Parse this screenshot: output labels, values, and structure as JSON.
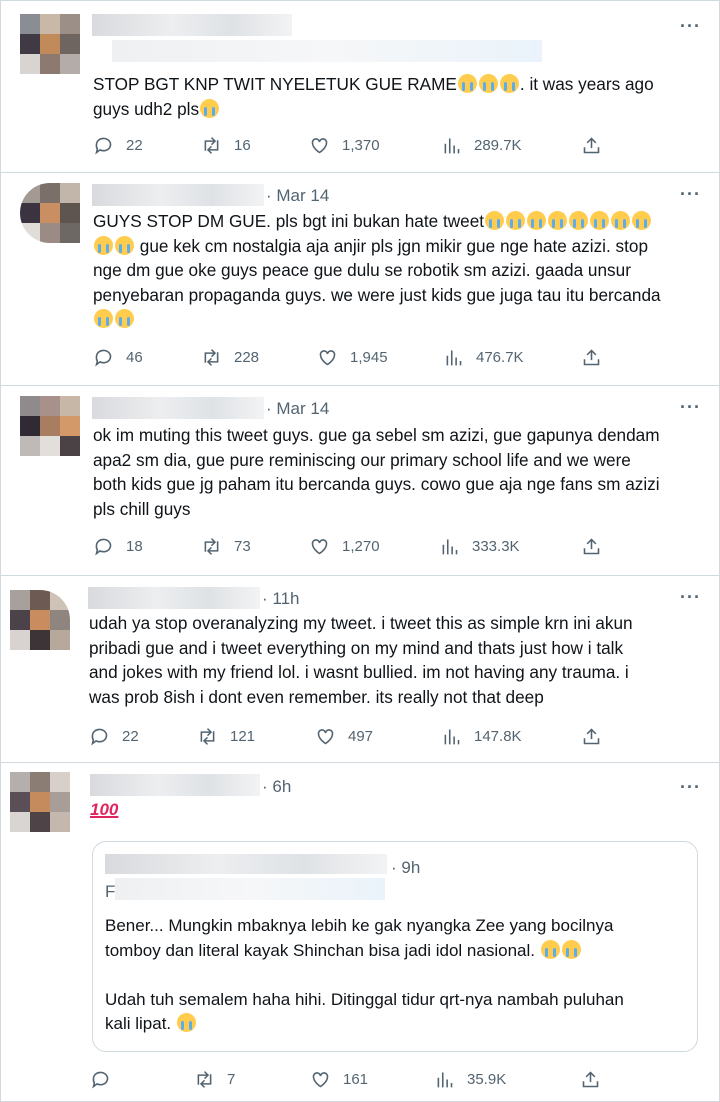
{
  "tweets": [
    {
      "time": "",
      "text": "STOP BGT KNP TWIT NYELETUK GUE RAME",
      "text_after": ". it was years ago",
      "line2": "guys udh2 pls",
      "replies": "22",
      "retweets": "16",
      "likes": "1,370",
      "views": "289.7K"
    },
    {
      "time": "· Mar 14",
      "line1": "GUYS STOP DM GUE. pls bgt ini bukan hate tweet",
      "line2": "gue kek cm nostalgia aja anjir pls jgn mikir gue nge hate azizi. stop",
      "line3": "nge dm gue oke guys peace gue dulu se robotik sm azizi. gaada unsur",
      "line4": "penyebaran propaganda guys. we were just kids gue juga tau itu bercanda",
      "replies": "46",
      "retweets": "228",
      "likes": "1,945",
      "views": "476.7K"
    },
    {
      "time": "· Mar 14",
      "line1": "ok im muting this tweet guys. gue ga sebel sm azizi, gue gapunya dendam",
      "line2": "apa2 sm dia, gue pure reminiscing our primary school life and we were",
      "line3": "both kids gue jg paham itu bercanda guys. cowo gue aja nge fans sm azizi",
      "line4": "pls chill guys",
      "replies": "18",
      "retweets": "73",
      "likes": "1,270",
      "views": "333.3K"
    },
    {
      "time": "· 11h",
      "line1": "udah ya stop overanalyzing my tweet. i tweet this as simple krn ini akun",
      "line2": "pribadi gue and i tweet everything on my mind and thats just how i talk",
      "line3": "and jokes with my friend lol. i wasnt bullied. im not having any trauma. i",
      "line4": "was prob 8ish i dont even remember. its really not that deep",
      "replies": "22",
      "retweets": "121",
      "likes": "497",
      "views": "147.8K"
    },
    {
      "time": "· 6h",
      "emoji_text": "100",
      "replies": "",
      "retweets": "7",
      "likes": "161",
      "views": "35.9K",
      "quote": {
        "time": "· 9h",
        "handle_initial": "F",
        "line1": "Bener... Mungkin mbaknya lebih ke gak nyangka Zee yang bocilnya",
        "line2": "tomboy dan literal kayak Shinchan bisa jadi idol nasional.",
        "line3": "Udah tuh semalem haha hihi. Ditinggal tidur qrt-nya nambah puluhan",
        "line4": "kali lipat."
      }
    }
  ],
  "icons": [
    "reply-icon",
    "retweet-icon",
    "like-icon",
    "views-icon",
    "share-icon",
    "more-icon"
  ],
  "colors": {
    "text": "#0f1419",
    "muted": "#536471",
    "border": "#cfd9de"
  }
}
